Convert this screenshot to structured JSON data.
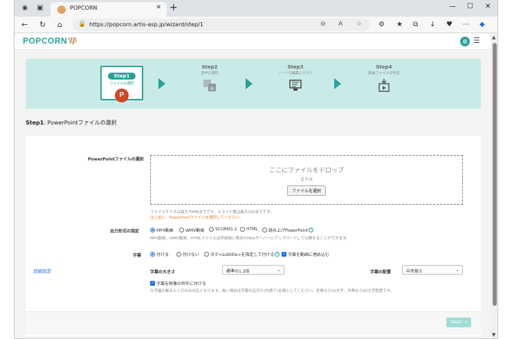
{
  "browser": {
    "tab_title": "POPCORN",
    "url": "https://popcorn.artis-asp.jp/wizard/step/1"
  },
  "app": {
    "logo_text": "POPCORN"
  },
  "steps": [
    {
      "num": "Step1",
      "desc": "ファイルの選択"
    },
    {
      "num": "Step2",
      "desc": "音声の選択"
    },
    {
      "num": "Step3",
      "desc": "ノートの編集とテスト"
    },
    {
      "num": "Step4",
      "desc": "動画ファイルの作成"
    }
  ],
  "step_heading": {
    "prefix": "Step1",
    "text": ": PowerPointファイルの選択"
  },
  "form": {
    "file_label": "PowerPointファイルの選択",
    "drop_text": "ここにファイルをドロップ",
    "or_text": "または",
    "choose_button": "ファイルを選択",
    "size_note": "ファイルサイズは最大70MBまでです。スライド数は最大100までです。",
    "warn_note": "はじめに、PowerPointファイルを選択してください。",
    "output_label": "出力形式の指定",
    "output_options": [
      "MP4動画",
      "WMV動画",
      "SCORM1.2",
      "HTML",
      "読み上げPowerPoint"
    ],
    "output_note": "MP4動画、WMV動画、HTMLファイルは作成後に専用のWebサーバーにアップロードして公開することができます。",
    "subtitle_label": "字幕",
    "subtitle_options": [
      "付ける",
      "付けない",
      "タグ<subtitle>を指定して付ける"
    ],
    "burn_in": "字幕を動画に埋め込む",
    "size_label": "字幕の大きさ",
    "size_value": "標準の1.2倍",
    "align_label": "字幕の配置",
    "align_value": "中央揃え",
    "outside_check": "字幕を映像の枠外に付ける",
    "subtitle_note": "文字幅の都合上１行のみ対応となります。長い場合は字幕の区切り(句読て)を挿入してください。全角なら50文字、半角なら80文字程度です。",
    "advanced_link": "詳細設定",
    "next_button": "Step2 →"
  },
  "colors": {
    "accent": "#2aa198",
    "steps_bg": "#c9ebe8",
    "warn": "#e67e22",
    "link": "#1a73e8"
  }
}
